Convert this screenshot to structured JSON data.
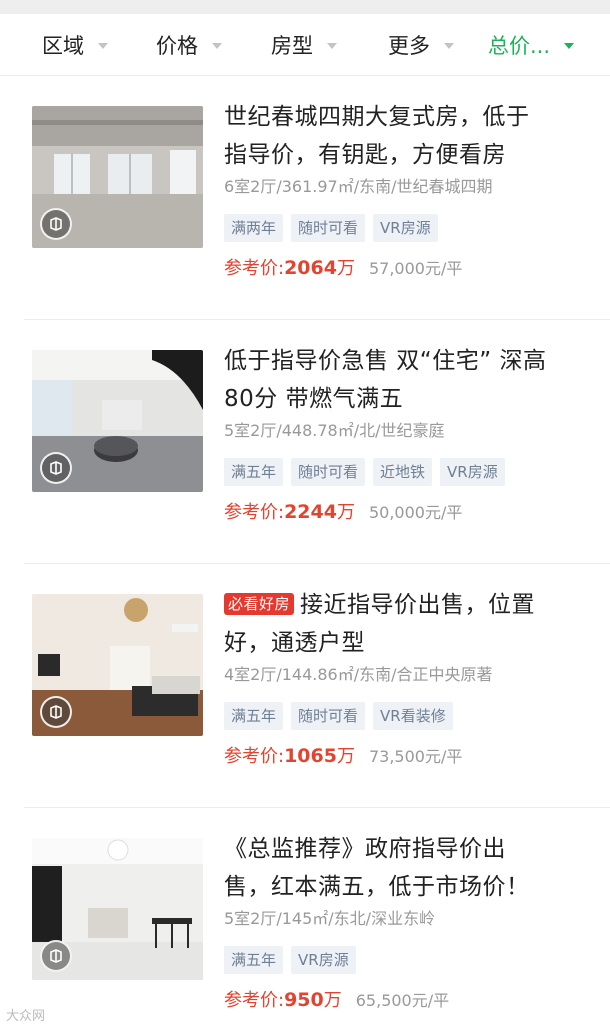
{
  "filters": [
    {
      "label": "区域",
      "active": false
    },
    {
      "label": "价格",
      "active": false
    },
    {
      "label": "房型",
      "active": false
    },
    {
      "label": "更多",
      "active": false
    },
    {
      "label": "总价...",
      "active": true
    }
  ],
  "listings": [
    {
      "title_line1": "世纪春城四期大复式房，低于",
      "title_line2": "指导价，有钥匙，方便看房",
      "badge": "",
      "meta": "6室2厅/361.97㎡/东南/世纪春城四期",
      "tags": [
        "满两年",
        "随时可看",
        "VR房源"
      ],
      "price_prefix": "参考价:",
      "price_value": "2064",
      "price_unit": "万",
      "unit_price": "57,000元/平",
      "vr_icon": "vr-house-icon"
    },
    {
      "title_line1": "低于指导价急售 双“住宅” 深高",
      "title_line2": "80分 带燃气满五",
      "badge": "",
      "meta": "5室2厅/448.78㎡/北/世纪豪庭",
      "tags": [
        "满五年",
        "随时可看",
        "近地铁",
        "VR房源"
      ],
      "price_prefix": "参考价:",
      "price_value": "2244",
      "price_unit": "万",
      "unit_price": "50,000元/平",
      "vr_icon": "vr-house-icon"
    },
    {
      "title_line1": "接近指导价出售，位置",
      "title_line2": "好，通透户型",
      "badge": "必看好房",
      "meta": "4室2厅/144.86㎡/东南/合正中央原著",
      "tags": [
        "满五年",
        "随时可看",
        "VR看装修"
      ],
      "price_prefix": "参考价:",
      "price_value": "1065",
      "price_unit": "万",
      "unit_price": "73,500元/平",
      "vr_icon": "vr-house-icon"
    },
    {
      "title_line1": "《总监推荐》政府指导价出",
      "title_line2": "售，红本满五，低于市场价！",
      "badge": "",
      "meta": "5室2厅/145㎡/东北/深业东岭",
      "tags": [
        "满五年",
        "VR房源"
      ],
      "price_prefix": "参考价:",
      "price_value": "950",
      "price_unit": "万",
      "unit_price": "65,500元/平",
      "vr_icon": "vr-house-icon"
    }
  ],
  "watermark": "大众网",
  "colors": {
    "accent_green": "#1bb35a",
    "price_red": "#e5432f",
    "badge_red": "#e5392f",
    "tag_bg": "#eef2f6",
    "tag_text": "#6f7f94"
  }
}
